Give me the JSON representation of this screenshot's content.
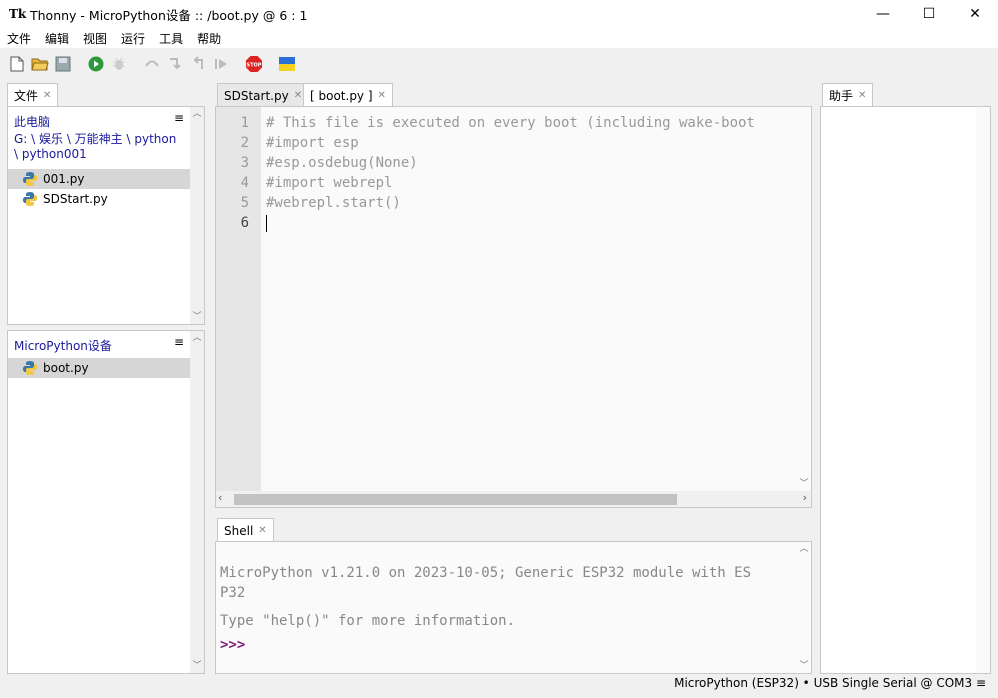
{
  "window": {
    "title": "Thonny  -  MicroPython设备 :: /boot.py  @  6 : 1",
    "app_icon": "Tk"
  },
  "menu": [
    "文件",
    "编辑",
    "视图",
    "运行",
    "工具",
    "帮助"
  ],
  "files_panel": {
    "tab": "文件",
    "local_header": "此电脑",
    "local_path_line1": "G: \\ 娱乐 \\ 万能神主 \\ python",
    "local_path_line2": "\\ python001",
    "local_files": [
      "001.py",
      "SDStart.py"
    ],
    "device_header": "MicroPython设备",
    "device_files": [
      "boot.py"
    ],
    "menu_icon": "≡"
  },
  "editor": {
    "tabs": [
      {
        "label": "SDStart.py",
        "active": false
      },
      {
        "label": "[ boot.py ]",
        "active": true
      }
    ],
    "line_numbers": [
      "1",
      "2",
      "3",
      "4",
      "5",
      "6"
    ],
    "lines": [
      "# This file is executed on every boot (including wake-boot",
      "#import esp",
      "#esp.osdebug(None)",
      "#import webrepl",
      "#webrepl.start()",
      ""
    ]
  },
  "shell": {
    "tab": "Shell",
    "banner_line1": "MicroPython v1.21.0 on 2023-10-05; Generic ESP32 module with ES",
    "banner_line2": "P32",
    "help_line": "Type \"help()\" for more information.",
    "prompt": ">>>"
  },
  "assistant": {
    "tab": "助手"
  },
  "status": {
    "text": "MicroPython (ESP32)  •  USB Single Serial @ COM3  ≡"
  }
}
